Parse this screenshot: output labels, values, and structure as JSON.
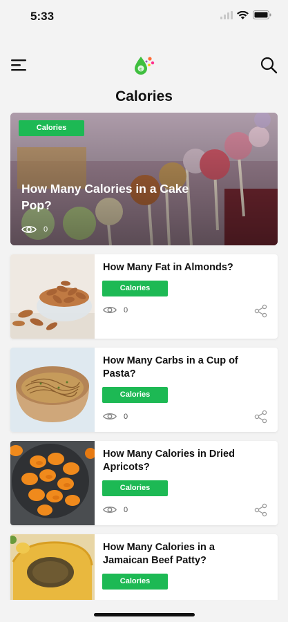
{
  "status_bar": {
    "time": "5:33"
  },
  "header": {
    "menu_icon": "hamburger-icon",
    "logo_icon": "app-logo",
    "search_icon": "search-icon"
  },
  "page": {
    "title": "Calories"
  },
  "hero": {
    "badge": "Calories",
    "title": "How Many Calories in a Cake Pop?",
    "views": "0"
  },
  "articles": [
    {
      "title": "How Many Fat in Almonds?",
      "badge": "Calories",
      "views": "0"
    },
    {
      "title": "How Many Carbs in a Cup of Pasta?",
      "badge": "Calories",
      "views": "0"
    },
    {
      "title": "How Many Calories in Dried Apricots?",
      "badge": "Calories",
      "views": "0"
    },
    {
      "title": "How Many Calories in a Jamaican Beef Patty?",
      "badge": "Calories",
      "views": ""
    }
  ],
  "colors": {
    "accent": "#1db954",
    "background": "#f3f3f3",
    "card": "#ffffff"
  }
}
